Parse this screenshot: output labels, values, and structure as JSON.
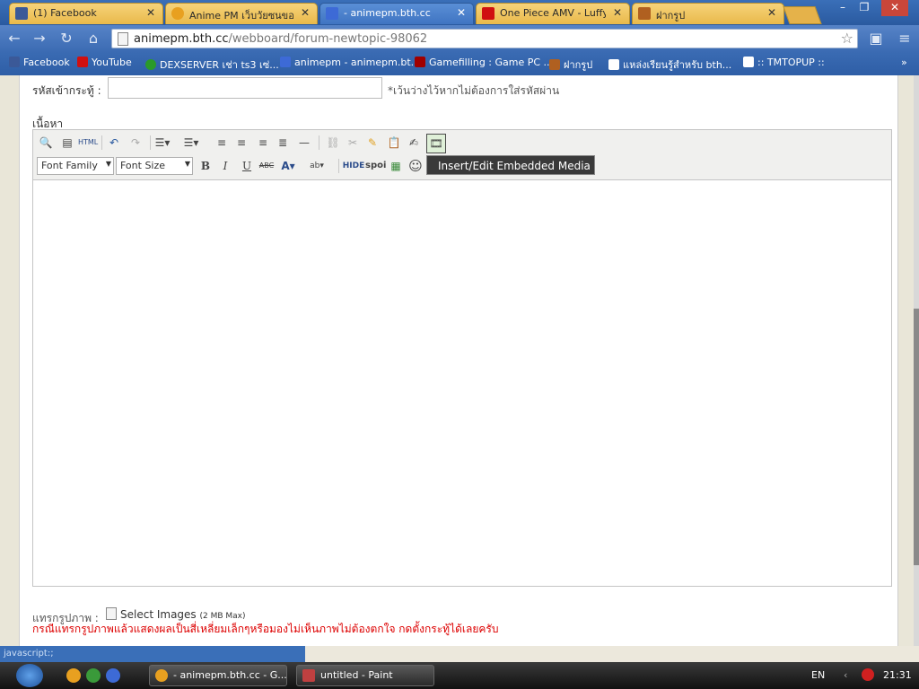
{
  "tabs": [
    {
      "title": "(1) Facebook",
      "color": "#3b5998"
    },
    {
      "title": "Anime PM เว็บวัยซนของคน",
      "color": "#e8a020"
    },
    {
      "title": "- animepm.bth.cc",
      "color": "#3d6ad6",
      "active": true
    },
    {
      "title": "One Piece AMV - Luffy V",
      "color": "#d01010"
    },
    {
      "title": "ฝากรูป",
      "color": "#b06020"
    }
  ],
  "window": {
    "minimize": "–",
    "restore": "❐",
    "close": "✕"
  },
  "address": {
    "host": "animepm.bth.cc",
    "path": "/webboard/forum-newtopic-98062"
  },
  "bookmarks": [
    {
      "label": "Facebook",
      "color": "#3b5998"
    },
    {
      "label": "YouTube",
      "color": "#d01010"
    },
    {
      "label": "DEXSERVER เช่า ts3 เซ่...",
      "color": "#2a9a2a"
    },
    {
      "label": "animepm - animepm.bt...",
      "color": "#3d6ad6"
    },
    {
      "label": "Gamefilling : Game PC ...",
      "color": "#a00000"
    },
    {
      "label": "ฝากรูป",
      "color": "#b06020"
    },
    {
      "label": "แหล่งเรียนรู้สำหรับ bth...",
      "color": "#ffffff"
    },
    {
      "label": ":: TMTOPUP ::",
      "color": "#ffffff"
    }
  ],
  "form": {
    "password_label": "รหัสเข้ากระทู้ :",
    "password_value": "",
    "password_note": "*เว้นว่างไว้หากไม่ต้องการใส่รหัสผ่าน",
    "content_label": "เนื้อหา"
  },
  "editor": {
    "font_family": "Font Family",
    "font_size": "Font Size",
    "html_label": "HTML",
    "hide_label": "HIDE",
    "spoi_label": "spoi",
    "tooltip": "Insert/Edit Embedded Media"
  },
  "attach": {
    "label": "แทรกรูปภาพ :",
    "select": "Select Images",
    "max": "(2 MB Max)",
    "warning": "กรณีแทรกรูปภาพแล้วแสดงผลเป็นสี่เหลี่ยมเล็กๆหรือมองไม่เห็นภาพไม่ต้องตกใจ กดตั้งกระทู้ได้เลยครับ"
  },
  "status_bar": "javascript:;",
  "taskbar": {
    "tasks": [
      {
        "label": "- animepm.bth.cc - G...",
        "color": "#e8a020"
      },
      {
        "label": "untitled - Paint",
        "color": "#c04040"
      }
    ],
    "lang": "EN",
    "time": "21:31"
  }
}
